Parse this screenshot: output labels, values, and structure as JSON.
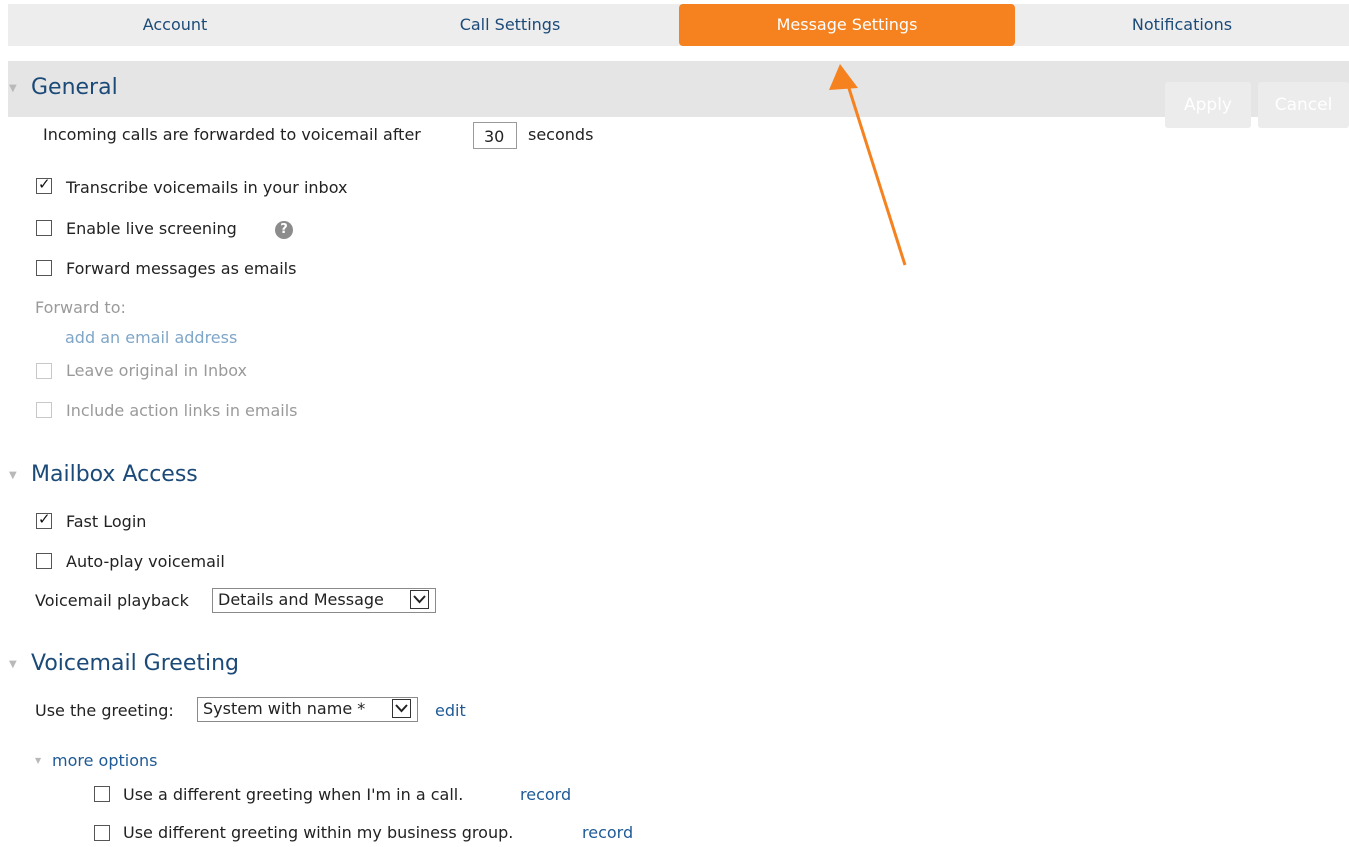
{
  "tabs": [
    {
      "label": "Account"
    },
    {
      "label": "Call Settings"
    },
    {
      "label": "Message Settings",
      "active": true
    },
    {
      "label": "Notifications"
    }
  ],
  "actions": {
    "apply_label": "Apply",
    "cancel_label": "Cancel"
  },
  "general": {
    "title": "General",
    "forward_prefix": "Incoming calls are forwarded to voicemail after",
    "forward_seconds": "30",
    "forward_suffix": "seconds",
    "options": [
      {
        "label": "Transcribe voicemails in your inbox",
        "checked": true
      },
      {
        "label": "Enable live screening",
        "checked": false
      },
      {
        "label": "Forward messages as emails",
        "checked": false
      }
    ],
    "help_glyph": "?",
    "forward_to_label": "Forward to:",
    "add_email_link": "add an email address",
    "disabled_options": [
      {
        "label": "Leave original in Inbox",
        "checked": false
      },
      {
        "label": "Include action links in emails",
        "checked": false
      }
    ]
  },
  "mailbox": {
    "title": "Mailbox Access",
    "options": [
      {
        "label": "Fast Login",
        "checked": true
      },
      {
        "label": "Auto-play voicemail",
        "checked": false
      }
    ],
    "playback_label": "Voicemail playback",
    "playback_value": "Details and Message"
  },
  "greeting": {
    "title": "Voicemail Greeting",
    "use_label": "Use the greeting:",
    "greeting_value": "System with name *",
    "edit_link": "edit",
    "more_options_link": "more options",
    "more_options": [
      {
        "label": "Use a different greeting when I'm in a call.",
        "link": "record",
        "checked": false
      },
      {
        "label": "Use different greeting within my business group.",
        "link": "record",
        "checked": false
      }
    ]
  },
  "colors": {
    "accent": "#f5821f",
    "heading": "#1c4a78",
    "link": "#1f5a96"
  },
  "icons": {
    "collapse": "triangle-down-icon",
    "help": "help-icon",
    "dropdown": "chevron-down-icon",
    "annotation": "arrow-icon"
  }
}
